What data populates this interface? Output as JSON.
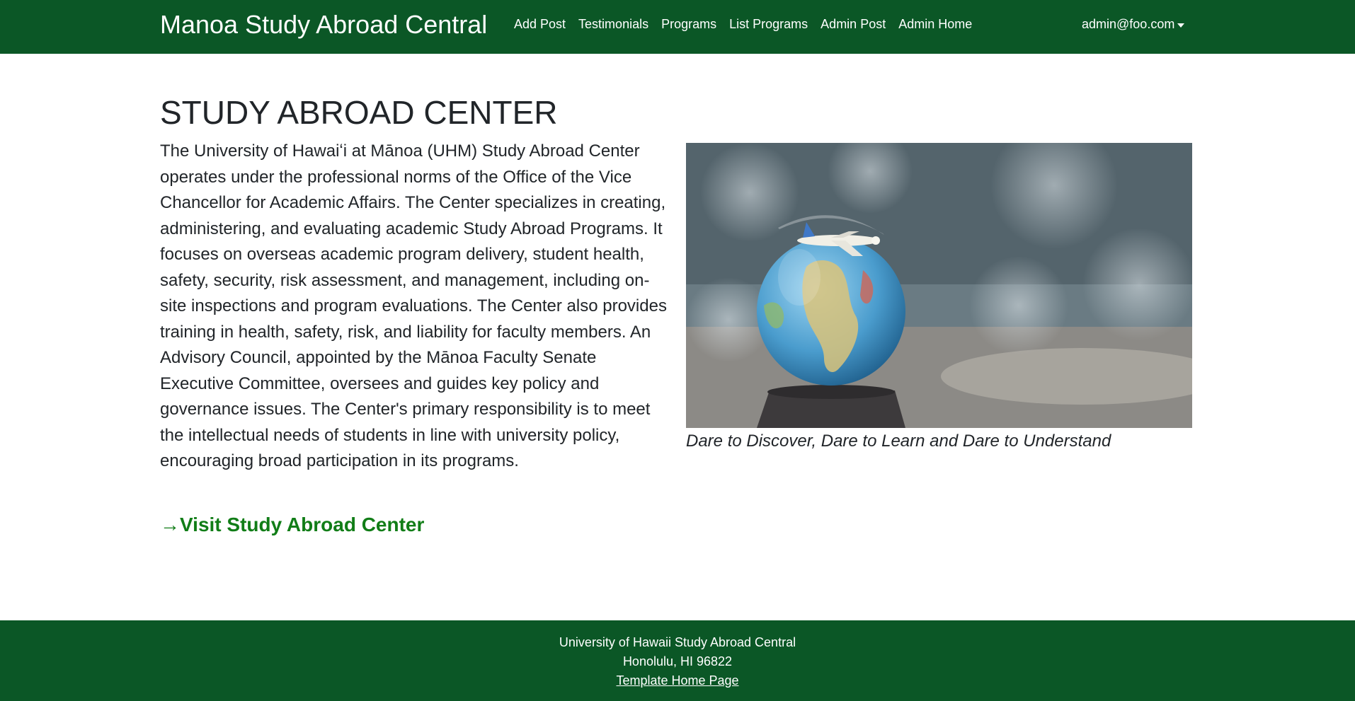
{
  "navbar": {
    "brand": "Manoa Study Abroad Central",
    "links": [
      "Add Post",
      "Testimonials",
      "Programs",
      "List Programs",
      "Admin Post",
      "Admin Home"
    ],
    "user": "admin@foo.com"
  },
  "main": {
    "title": "STUDY ABROAD CENTER",
    "intro": "The University of Hawaiʻi at Mānoa (UHM) Study Abroad Center operates under the professional norms of the Office of the Vice Chancellor for Academic Affairs. The Center specializes in creating, administering, and evaluating academic Study Abroad Programs. It focuses on overseas academic program delivery, student health, safety, security, risk assessment, and management, including on-site inspections and program evaluations. The Center also provides training in health, safety, risk, and liability for faculty members. An Advisory Council, appointed by the Mānoa Faculty Senate Executive Committee, oversees and guides key policy and governance issues. The Center's primary responsibility is to meet the intellectual needs of students in line with university policy, encouraging broad participation in its programs.",
    "caption": "Dare to Discover, Dare to Learn and Dare to Understand",
    "visit_arrow": "→",
    "visit_label": "Visit Study Abroad Center"
  },
  "footer": {
    "line1": "University of Hawaii Study Abroad Central",
    "line2": "Honolulu, HI 96822",
    "link": "Template Home Page"
  },
  "colors": {
    "navbar_bg": "#0b5726",
    "link_green": "#117d17",
    "text": "#212529"
  }
}
